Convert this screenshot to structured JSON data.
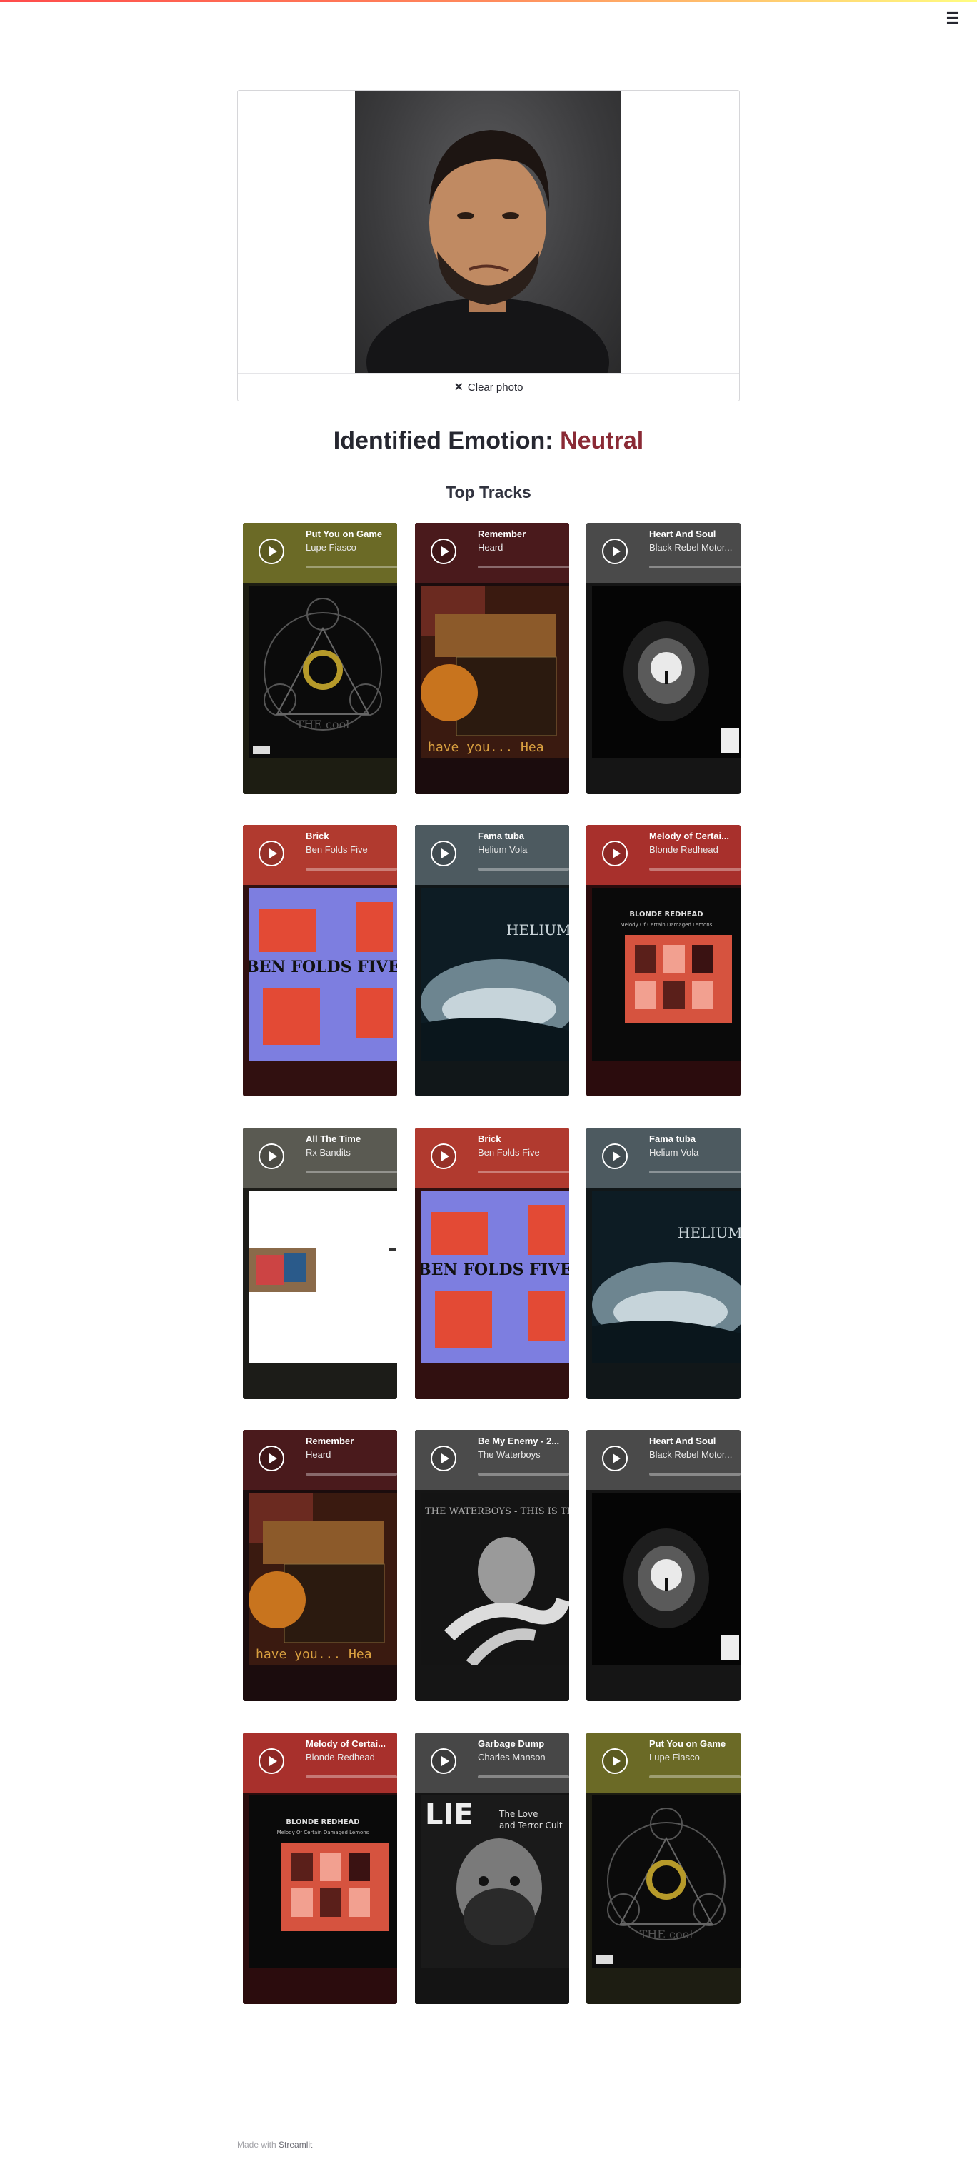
{
  "header": {
    "menu_icon": "hamburger-menu-icon"
  },
  "uploader": {
    "clear_label": "Clear photo",
    "clear_icon": "close-icon"
  },
  "emotion": {
    "label": "Identified Emotion:",
    "value": "Neutral",
    "value_color": "#8a2a35"
  },
  "section_title": "Top Tracks",
  "tracks": [
    {
      "title": "Put You on Game",
      "artist": "Lupe Fiasco",
      "cover": "lupe"
    },
    {
      "title": "Remember",
      "artist": "Heard",
      "cover": "heard"
    },
    {
      "title": "Heart And Soul",
      "artist": "Black Rebel Motor...",
      "cover": "brmc"
    },
    {
      "title": "Brick",
      "artist": "Ben Folds Five",
      "cover": "bff"
    },
    {
      "title": "Fama tuba",
      "artist": "Helium Vola",
      "cover": "helium"
    },
    {
      "title": "Melody of Certai...",
      "artist": "Blonde Redhead",
      "cover": "blonde"
    },
    {
      "title": "All The Time",
      "artist": "Rx Bandits",
      "cover": "rx"
    },
    {
      "title": "Brick",
      "artist": "Ben Folds Five",
      "cover": "bff"
    },
    {
      "title": "Fama tuba",
      "artist": "Helium Vola",
      "cover": "helium"
    },
    {
      "title": "Remember",
      "artist": "Heard",
      "cover": "heard"
    },
    {
      "title": "Be My Enemy - 2...",
      "artist": "The Waterboys",
      "cover": "waterboys"
    },
    {
      "title": "Heart And Soul",
      "artist": "Black Rebel Motor...",
      "cover": "brmc"
    },
    {
      "title": "Melody of Certai...",
      "artist": "Blonde Redhead",
      "cover": "blonde"
    },
    {
      "title": "Garbage Dump",
      "artist": "Charles Manson",
      "cover": "manson"
    },
    {
      "title": "Put You on Game",
      "artist": "Lupe Fiasco",
      "cover": "lupe"
    }
  ],
  "cover_text": {
    "bff": "BEN FOLDS FIVE",
    "helium": "HELIUMVO",
    "heard": "have you... Hea",
    "waterboys": "THE WATERBOYS - THIS IS THE S",
    "manson_title": "LIE",
    "manson_sub": "The Love and Terror Cult",
    "blonde_title": "BLONDE REDHEAD",
    "blonde_sub": "Melody Of Certain Damaged Lemons",
    "lupe": "THE COOL"
  },
  "footer": {
    "prefix": "Made with",
    "brand": "Streamlit"
  }
}
